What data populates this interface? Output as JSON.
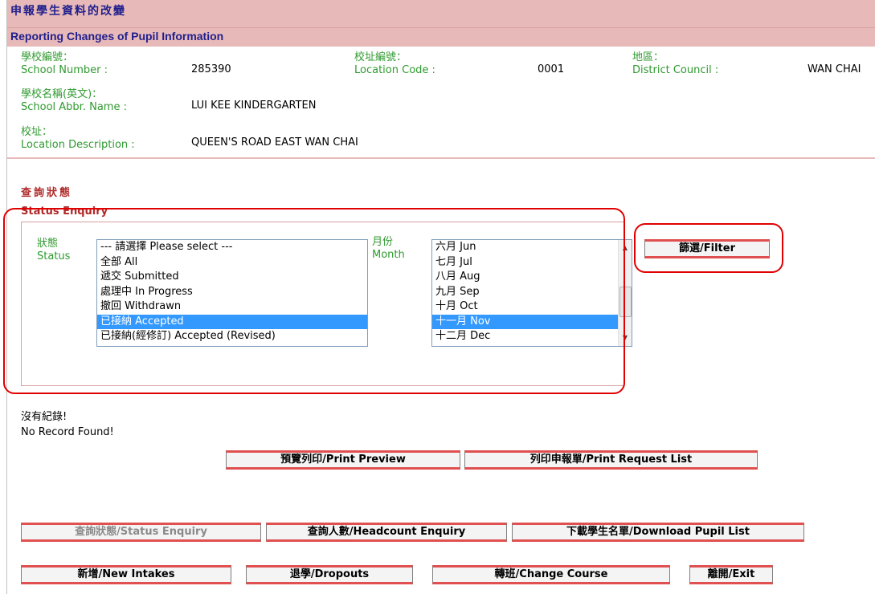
{
  "header": {
    "title_zh": "申報學生資料的改變",
    "title_en": "Reporting Changes of Pupil Information"
  },
  "school_info": {
    "school_number_label_zh": "學校編號：",
    "school_number_label_en": "School Number :",
    "school_number": "285390",
    "location_code_label_zh": "校址編號：",
    "location_code_label_en": "Location Code :",
    "location_code": "0001",
    "district_label_zh": "地區：",
    "district_label_en": "District Council :",
    "district": "WAN CHAI",
    "abbr_name_label_zh": "學校名稱(英文)：",
    "abbr_name_label_en": "School Abbr. Name :",
    "abbr_name": "LUI KEE KINDERGARTEN",
    "location_desc_label_zh": "校址：",
    "location_desc_label_en": "Location Description :",
    "location_desc": "QUEEN'S ROAD EAST WAN CHAI"
  },
  "status_enquiry": {
    "title_zh": "查詢狀態",
    "title_en": "Status Enquiry",
    "status_label_zh": "狀態",
    "status_label_en": "Status",
    "status_options": [
      "--- 請選擇 Please select ---",
      "全部 All",
      "遞交 Submitted",
      "處理中 In Progress",
      "撤回 Withdrawn",
      "已接納 Accepted",
      "已接納(經修訂) Accepted (Revised)"
    ],
    "status_selected": "已接納 Accepted",
    "month_label_zh": "月份",
    "month_label_en": "Month",
    "month_options": [
      "六月 Jun",
      "七月 Jul",
      "八月 Aug",
      "九月 Sep",
      "十月 Oct",
      "十一月 Nov",
      "十二月 Dec"
    ],
    "month_selected": "十一月 Nov",
    "filter_button": "篩選/Filter"
  },
  "results": {
    "no_record_zh": "沒有紀錄!",
    "no_record_en": "No Record Found!"
  },
  "actions": {
    "print_preview": "預覽列印/Print Preview",
    "print_request_list": "列印申報單/Print Request List"
  },
  "nav": {
    "status_enquiry": "查詢狀態/Status Enquiry",
    "headcount_enquiry": "查詢人數/Headcount Enquiry",
    "download_pupil_list": "下載學生名單/Download Pupil List",
    "new_intakes": "新增/New Intakes",
    "dropouts": "退學/Dropouts",
    "change_course": "轉班/Change Course",
    "exit": "離開/Exit"
  },
  "colors": {
    "header_bg": "#e8b9b9",
    "label_green": "#2f9a2f",
    "title_red": "#b02a2a",
    "selection_blue": "#3399ff",
    "annotation_red": "#e00000"
  }
}
